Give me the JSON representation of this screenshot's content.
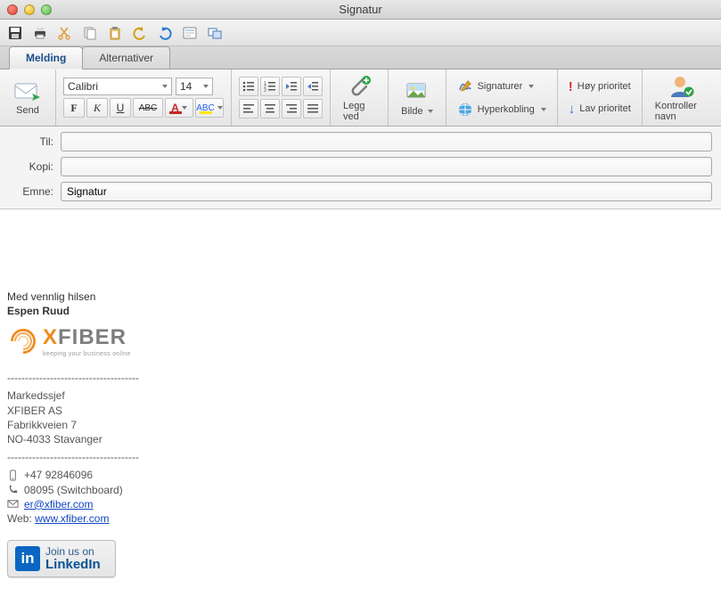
{
  "window": {
    "title": "Signatur"
  },
  "tabs": {
    "melding": "Melding",
    "alternativer": "Alternativer"
  },
  "ribbon": {
    "send": "Send",
    "font_name": "Calibri",
    "font_size": "14",
    "legg_ved": "Legg ved",
    "bilde": "Bilde",
    "signaturer": "Signaturer",
    "hyperkobling": "Hyperkobling",
    "hoy": "Høy prioritet",
    "lav": "Lav prioritet",
    "kontroller": "Kontroller navn"
  },
  "fields": {
    "til_label": "Til:",
    "kopi_label": "Kopi:",
    "emne_label": "Emne:",
    "til_value": "",
    "kopi_value": "",
    "emne_value": "Signatur"
  },
  "signature": {
    "greeting": "Med vennlig hilsen",
    "name": "Espen Ruud",
    "logo_text_plain": "FIBER",
    "logo_text_accent": "X",
    "logo_tagline": "keeping your business online",
    "divider": "-------------------------------------",
    "title": "Markedssjef",
    "company": "XFIBER AS",
    "address1": "Fabrikkveien 7",
    "address2": "NO-4033 Stavanger",
    "mobile": "+47 92846096",
    "switchboard": "08095 (Switchboard)",
    "email_icon_prefix": "✉",
    "email": "er@xfiber.com",
    "web_prefix": "Web: ",
    "web": "www.xfiber.com",
    "linkedin_line1": "Join us on",
    "linkedin_line2": "LinkedIn"
  }
}
